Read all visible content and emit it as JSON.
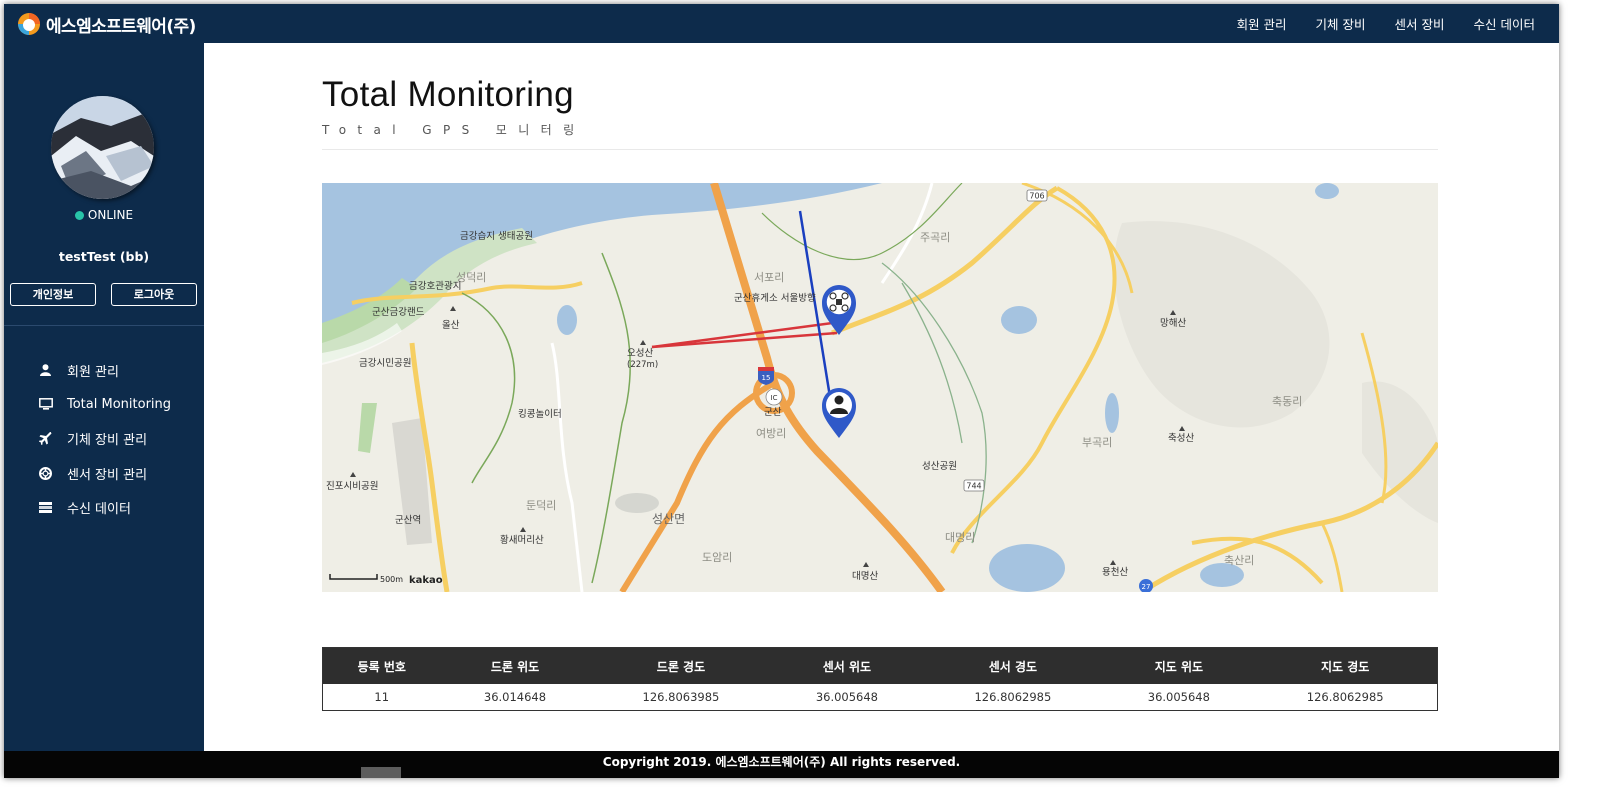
{
  "brand": {
    "name": "에스엠소프트웨어(주)"
  },
  "topnav": {
    "items": [
      "회원 관리",
      "기체 장비",
      "센서 장비",
      "수신 데이터"
    ]
  },
  "sidebar": {
    "status": "ONLINE",
    "username": "testTest (bb)",
    "profile_button": "개인정보",
    "logout_button": "로그아웃",
    "menu": [
      "회원 관리",
      "Total Monitoring",
      "기체 장비 관리",
      "센서 장비 관리",
      "수신 데이터"
    ]
  },
  "page": {
    "title": "Total Monitoring",
    "subtitle": "Total GPS 모니터링"
  },
  "map": {
    "labels": {
      "jugok": "주곡리",
      "geumgang_ecopark": "금강습지 생태공원",
      "seongdeok": "성덕리",
      "geumgang_lake": "금강호관광지",
      "gunsan_geumgang_land": "군산금강랜드",
      "olsan": "올산",
      "seopo": "서포리",
      "rest_area": "군산휴게소 서울방향",
      "osungsan": "오성산",
      "osungsan_height": "(227m)",
      "geumgang_park": "금강시민공원",
      "manghaesan": "망해산",
      "kingkong": "킹콩놀이터",
      "gunsan": "군산",
      "yeobang": "여방리",
      "chukdong": "축동리",
      "bugok": "부곡리",
      "chukseongsan": "축성산",
      "seongsan_park": "성산공원",
      "jinpo_park": "진포시비공원",
      "dunduk": "둔덕리",
      "seongsan_myeon": "성산면",
      "gunsan_station": "군산역",
      "hwangsae": "황새머리산",
      "doam": "도암리",
      "daemyeong_ri": "대명리",
      "daemyeongsan": "대명산",
      "yongcheonsan": "용천산",
      "chuksan": "축산리",
      "ic": "IC",
      "route_706": "706",
      "route_744": "744",
      "route_27": "27",
      "route_15": "15",
      "scale": "500m",
      "kakao": "kakao"
    },
    "marker_icons": [
      "drone-marker-icon",
      "person-marker-icon"
    ],
    "colors": {
      "drone_line": "#d8363b",
      "sensor_line": "#1a3fbf",
      "marker": "#2f59c8"
    }
  },
  "table": {
    "headers": [
      "등록 번호",
      "드론 위도",
      "드론 경도",
      "센서 위도",
      "센서 경도",
      "지도 위도",
      "지도 경도"
    ],
    "rows": [
      [
        "11",
        "36.014648",
        "126.8063985",
        "36.005648",
        "126.8062985",
        "36.005648",
        "126.8062985"
      ]
    ]
  },
  "footer": {
    "text": "Copyright 2019. 에스엠소프트웨어(주) All rights reserved."
  },
  "colors": {
    "sidebar": "#0d2b4b",
    "status_online": "#28c4a8",
    "table_header": "#2e2e2e"
  }
}
